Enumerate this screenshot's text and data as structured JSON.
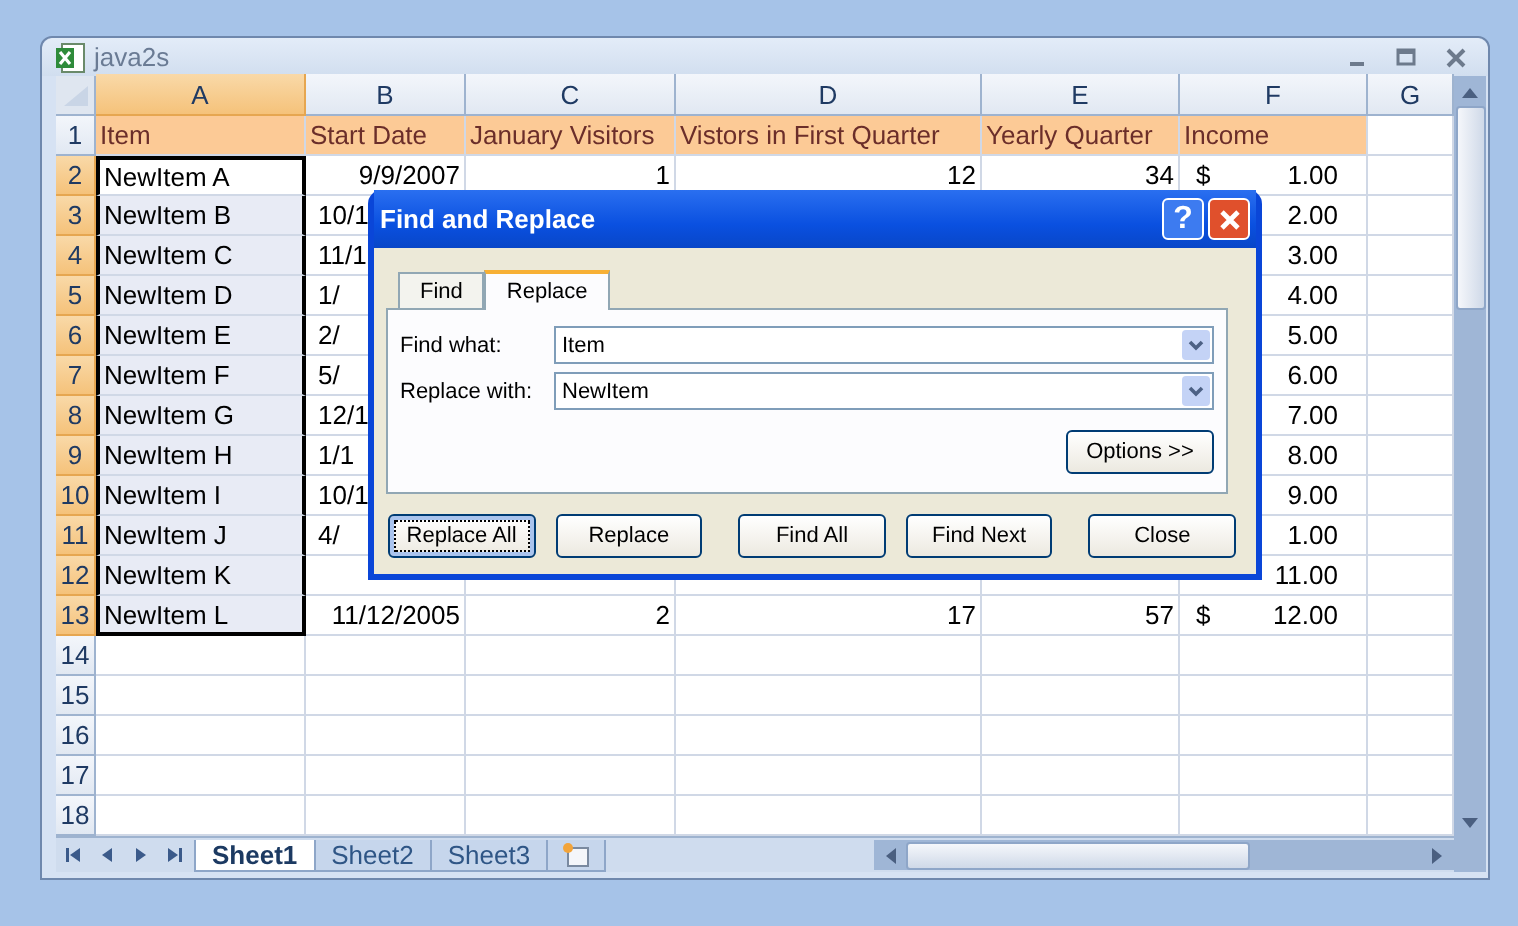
{
  "window": {
    "title": "java2s"
  },
  "columns": [
    {
      "label": "A",
      "selected": true
    },
    {
      "label": "B",
      "selected": false
    },
    {
      "label": "C",
      "selected": false
    },
    {
      "label": "D",
      "selected": false
    },
    {
      "label": "E",
      "selected": false
    },
    {
      "label": "F",
      "selected": false
    },
    {
      "label": "G",
      "selected": false
    }
  ],
  "header_row": {
    "header": "1",
    "cells": [
      "Item",
      "Start Date",
      "January Visitors",
      "Vistors in First Quarter",
      "Yearly Quarter",
      "Income"
    ]
  },
  "rows": [
    {
      "header": "2",
      "selected": true,
      "active": true,
      "covered": false,
      "cells": [
        "NewItem A",
        "9/9/2007",
        "1",
        "12",
        "34"
      ],
      "currency": "$",
      "amount": "1.00"
    },
    {
      "header": "3",
      "selected": true,
      "active": false,
      "covered": true,
      "cells": [
        "NewItem B",
        "10/1"
      ],
      "amount": "2.00"
    },
    {
      "header": "4",
      "selected": true,
      "active": false,
      "covered": true,
      "cells": [
        "NewItem C",
        "11/1"
      ],
      "amount": "3.00"
    },
    {
      "header": "5",
      "selected": true,
      "active": false,
      "covered": true,
      "cells": [
        "NewItem D",
        "1/"
      ],
      "amount": "4.00"
    },
    {
      "header": "6",
      "selected": true,
      "active": false,
      "covered": true,
      "cells": [
        "NewItem E",
        "2/"
      ],
      "amount": "5.00"
    },
    {
      "header": "7",
      "selected": true,
      "active": false,
      "covered": true,
      "cells": [
        "NewItem F",
        "5/"
      ],
      "amount": "6.00"
    },
    {
      "header": "8",
      "selected": true,
      "active": false,
      "covered": true,
      "cells": [
        "NewItem G",
        "12/1"
      ],
      "amount": "7.00"
    },
    {
      "header": "9",
      "selected": true,
      "active": false,
      "covered": true,
      "cells": [
        "NewItem H",
        "1/1"
      ],
      "amount": "8.00"
    },
    {
      "header": "10",
      "selected": true,
      "active": false,
      "covered": true,
      "cells": [
        "NewItem I",
        "10/1"
      ],
      "amount": "9.00"
    },
    {
      "header": "11",
      "selected": true,
      "active": false,
      "covered": true,
      "cells": [
        "NewItem J",
        "4/"
      ],
      "amount": "1.00"
    },
    {
      "header": "12",
      "selected": true,
      "active": false,
      "covered": false,
      "cells": [
        "NewItem K"
      ],
      "amount": "11.00"
    },
    {
      "header": "13",
      "selected": true,
      "active": false,
      "covered": false,
      "cells": [
        "NewItem L",
        "11/12/2005",
        "2",
        "17",
        "57"
      ],
      "currency": "$",
      "amount": "12.00"
    },
    {
      "header": "14",
      "selected": false,
      "active": false
    },
    {
      "header": "15",
      "selected": false,
      "active": false
    },
    {
      "header": "16",
      "selected": false,
      "active": false
    },
    {
      "header": "17",
      "selected": false,
      "active": false
    },
    {
      "header": "18",
      "selected": false,
      "active": false
    }
  ],
  "sheet_tabs": [
    {
      "label": "Sheet1",
      "selected": true
    },
    {
      "label": "Sheet2",
      "selected": false
    },
    {
      "label": "Sheet3",
      "selected": false
    }
  ],
  "dialog": {
    "title": "Find and Replace",
    "help": "?",
    "tabs": [
      {
        "label": "Find",
        "selected": false
      },
      {
        "label": "Replace",
        "selected": true
      }
    ],
    "fields": [
      {
        "label": "Find what:",
        "value": "Item"
      },
      {
        "label": "Replace with:",
        "value": "NewItem"
      }
    ],
    "options_button": "Options >>",
    "buttons": [
      {
        "label": "Replace All",
        "focused": true
      },
      {
        "label": "Replace",
        "focused": false
      },
      {
        "label": "Find All",
        "focused": false
      },
      {
        "label": "Find Next",
        "focused": false
      },
      {
        "label": "Close",
        "focused": false
      }
    ]
  }
}
